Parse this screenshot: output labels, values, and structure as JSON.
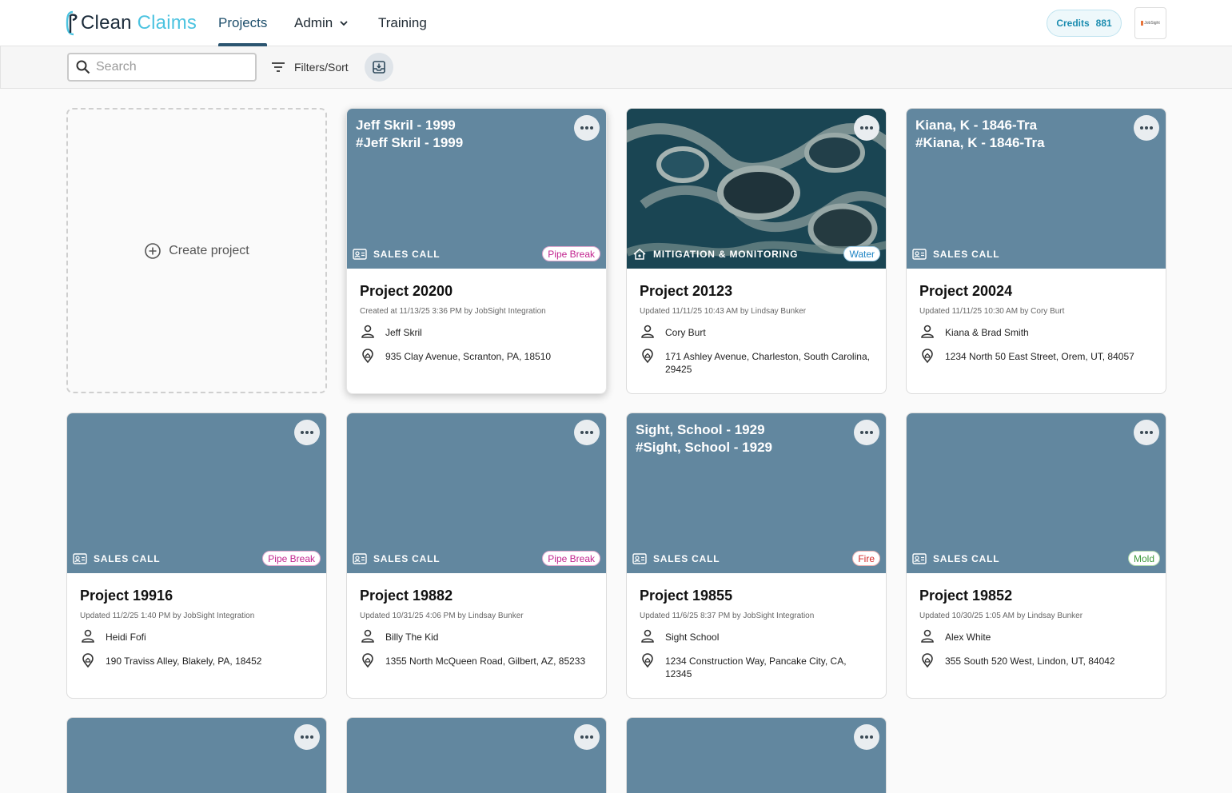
{
  "app": {
    "logo_part1": "Clean",
    "logo_part2": "Claims"
  },
  "nav": {
    "projects": "Projects",
    "admin": "Admin",
    "training": "Training"
  },
  "credits": {
    "label": "Credits",
    "value": "881"
  },
  "avatar": {
    "text": "JobSight"
  },
  "toolbar": {
    "search_placeholder": "Search",
    "filters_label": "Filters/Sort"
  },
  "create": {
    "label": "Create project"
  },
  "cards": [
    {
      "claim1": "Jeff Skril - 1999",
      "claim2": "#Jeff Skril - 1999",
      "stage": "SALES CALL",
      "badge": "Pipe Break",
      "name": "Project 20200",
      "meta": "Created at 11/13/25 3:36 PM by JobSight Integration",
      "person": "Jeff Skril",
      "address": "935 Clay Avenue, Scranton, PA, 18510"
    },
    {
      "claim1": "",
      "claim2": "",
      "stage": "MITIGATION & MONITORING",
      "badge": "Water",
      "name": "Project 20123",
      "meta": "Updated 11/11/25 10:43 AM by Lindsay Bunker",
      "person": "Cory Burt",
      "address": "171 Ashley Avenue, Charleston, South Carolina, 29425"
    },
    {
      "claim1": "Kiana, K - 1846-Tra",
      "claim2": "#Kiana, K - 1846-Tra",
      "stage": "SALES CALL",
      "badge": "",
      "name": "Project 20024",
      "meta": "Updated 11/11/25 10:30 AM by Cory Burt",
      "person": "Kiana & Brad Smith",
      "address": "1234 North 50 East Street, Orem, UT, 84057"
    },
    {
      "claim1": "",
      "claim2": "",
      "stage": "SALES CALL",
      "badge": "Pipe Break",
      "name": "Project 19916",
      "meta": "Updated 11/2/25 1:40 PM by JobSight Integration",
      "person": "Heidi Fofi",
      "address": "190 Traviss Alley, Blakely, PA, 18452"
    },
    {
      "claim1": "",
      "claim2": "",
      "stage": "SALES CALL",
      "badge": "Pipe Break",
      "name": "Project 19882",
      "meta": "Updated 10/31/25 4:06 PM by Lindsay Bunker",
      "person": "Billy The Kid",
      "address": "1355 North McQueen Road, Gilbert, AZ, 85233"
    },
    {
      "claim1": "Sight, School - 1929",
      "claim2": "#Sight, School - 1929",
      "stage": "SALES CALL",
      "badge": "Fire",
      "name": "Project 19855",
      "meta": "Updated 11/6/25 8:37 PM by JobSight Integration",
      "person": "Sight School",
      "address": "1234 Construction Way, Pancake City, CA, 12345"
    },
    {
      "claim1": "",
      "claim2": "",
      "stage": "SALES CALL",
      "badge": "Mold",
      "name": "Project 19852",
      "meta": "Updated 10/30/25 1:05 AM by Lindsay Bunker",
      "person": "Alex White",
      "address": "355 South 520 West, Lindon, UT, 84042"
    }
  ],
  "colors": {
    "card_header": "#62879f",
    "accent": "#2b5570",
    "logo_accent": "#4cc3e0"
  }
}
